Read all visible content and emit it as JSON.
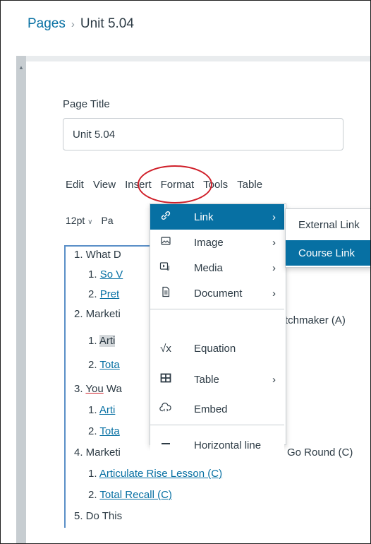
{
  "breadcrumb": {
    "root": "Pages",
    "separator": "›",
    "current": "Unit 5.04"
  },
  "page_title": {
    "label": "Page Title",
    "value": "Unit 5.04"
  },
  "menubar": [
    "Edit",
    "View",
    "Insert",
    "Format",
    "Tools",
    "Table"
  ],
  "toolbar": {
    "font_size": "12pt",
    "chevron": "∨",
    "paragraph_partial": "Pa"
  },
  "content": {
    "l1": "1. What D",
    "l2_num": "1. ",
    "l2_link": "So V",
    "l3_num": "2. ",
    "l3_link": "Pret",
    "l4a": "2. Marketi",
    "l4b": "tchmaker (A)",
    "l5_num": "1. ",
    "l5_text": "Arti",
    "l5_tail": ")",
    "l6_num": "2. ",
    "l6_link": "Tota",
    "l7_num": "3. ",
    "l7_you": "You",
    "l7_rest": " Wa",
    "l8_num": "1. ",
    "l8_link": "Arti",
    "l8_tail": ")",
    "l9_num": "2. ",
    "l9_link": "Tota",
    "l10a": "4. Marketi",
    "l10b": "Go Round (C)",
    "l11_num": "1. ",
    "l11_link": "Articulate Rise Lesson (C)",
    "l12_num": "2. ",
    "l12_link": "Total Recall (C)",
    "l13": "5. Do This"
  },
  "insert_menu": {
    "items": [
      {
        "label": "Link",
        "icon": "link-icon",
        "glyph": "🔗",
        "has_submenu": true
      },
      {
        "label": "Image",
        "icon": "image-icon",
        "glyph": "🖼",
        "has_submenu": true
      },
      {
        "label": "Media",
        "icon": "media-icon",
        "glyph": "▷",
        "has_submenu": true
      },
      {
        "label": "Document",
        "icon": "document-icon",
        "glyph": "▤",
        "has_submenu": true
      },
      {
        "label": "Equation",
        "icon": "equation-icon",
        "glyph": "√x",
        "has_submenu": false
      },
      {
        "label": "Table",
        "icon": "table-icon",
        "glyph": "⊞",
        "has_submenu": true
      },
      {
        "label": "Embed",
        "icon": "embed-icon",
        "glyph": "☁",
        "has_submenu": false
      },
      {
        "label": "Horizontal line",
        "icon": "horizontal-line-icon",
        "glyph": "—",
        "has_submenu": false
      }
    ],
    "submenu_arrow": "›"
  },
  "link_submenu": [
    "External Link",
    "Course Link"
  ],
  "colors": {
    "accent": "#0770a3",
    "highlight_circle": "#d0202a",
    "editor_border": "#5a8fc7"
  }
}
